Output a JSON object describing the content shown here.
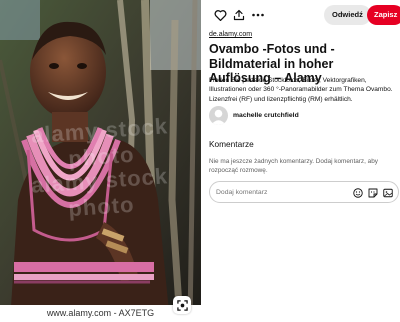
{
  "image": {
    "alt": "",
    "watermark_text": "alamy stock photo",
    "source_caption": "www.alamy.com - AX7ETG",
    "visual_search_icon": "visual-search-icon"
  },
  "toolbar": {
    "like_icon": "heart-icon",
    "share_icon": "share-icon",
    "more_icon": "more-dots-icon",
    "board_label": "Odwiedź",
    "save_label": "Zapisz",
    "save_color": "#e60023"
  },
  "pin": {
    "source_link": "de.alamy.com",
    "title": "Ovambo -Fotos und -Bildmaterial in hoher Auflösung – Alamy",
    "description": "Finden Sie perfekte Stockfotos, Bilder, Vektorgrafiken, Illustrationen oder 360 °-Panoramabilder zum Thema Ovambo. Lizenzfrei (RF) und lizenzpflichtig (RM) erhältlich."
  },
  "creator": {
    "name": "machelle crutchfield",
    "avatar_icon": "user-avatar-icon"
  },
  "comments": {
    "heading": "Komentarze",
    "empty_text": "Nie ma jeszcze żadnych komentarzy. Dodaj komentarz, aby rozpocząć rozmowę.",
    "input_placeholder": "Dodaj komentarz",
    "emoji_icon": "emoji-icon",
    "sticker_icon": "sticker-icon",
    "photo_icon": "photo-icon"
  }
}
